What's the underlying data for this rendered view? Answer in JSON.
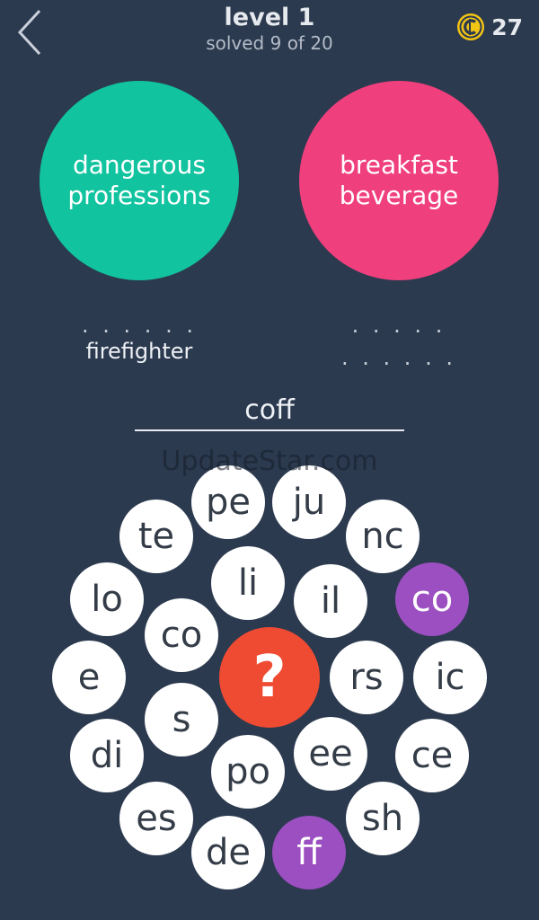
{
  "header": {
    "title": "level 1",
    "subtitle": "solved 9 of 20",
    "coins": "27"
  },
  "categories": [
    {
      "lines": [
        "dangerous",
        "professions"
      ],
      "color": "#11c39f",
      "slots": [
        ". . . . . .",
        ""
      ],
      "answers": [
        "",
        "firefighter"
      ]
    },
    {
      "lines": [
        "breakfast",
        "beverage"
      ],
      "color": "#ef3f7c",
      "slots": [
        ". . . . .",
        ". . . . . ."
      ],
      "answers": [
        "",
        ""
      ]
    }
  ],
  "input": {
    "current": "coff"
  },
  "watermark": "UpdateStar.com",
  "hint_symbol": "?",
  "tiles": [
    "pe",
    "ju",
    "te",
    "nc",
    "li",
    "lo",
    "il",
    "co",
    "co",
    "e",
    "rs",
    "ic",
    "s",
    "di",
    "ee",
    "ce",
    "po",
    "es",
    "sh",
    "de",
    "ff"
  ],
  "selected_tiles": [
    "co (right)",
    "ff"
  ],
  "colors": {
    "background": "#2c3a4f",
    "category_1": "#11c39f",
    "category_2": "#ef3f7c",
    "selected_tile": "#9b4fc0",
    "hint": "#ee4b32",
    "coin": "#f2c414"
  },
  "icons": {
    "back": "chevron-left-icon",
    "coin": "coin-icon",
    "hint": "question-mark-icon"
  }
}
